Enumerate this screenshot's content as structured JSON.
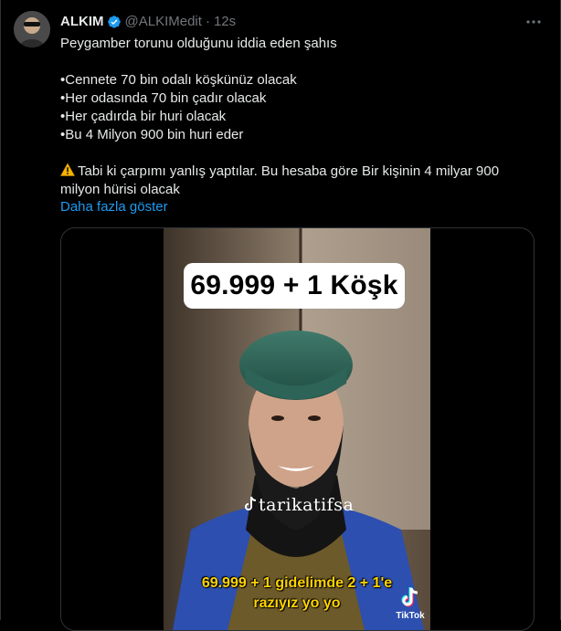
{
  "tweet": {
    "author_name": "ALKIM",
    "author_handle": "@ALKIMedit",
    "separator": "·",
    "time": "12s",
    "lines": [
      "Peygamber torunu olduğunu iddia eden şahıs",
      "",
      "•Cennete 70 bin odalı köşkünüz olacak",
      "•Her odasında 70 bin çadır olacak",
      "•Her çadırda bir huri olacak",
      "•Bu 4 Milyon 900 bin huri eder",
      "",
      "Tabi ki çarpımı yanlış yaptılar. Bu hesaba göre Bir kişinin 4 milyar 900",
      "milyon hürisi olacak"
    ],
    "show_more": "Daha fazla göster"
  },
  "video": {
    "title_overlay": "69.999 + 1 Köşk",
    "watermark": "tarikatifsa",
    "subtitle_line1": "69.999 + 1  gidelimde 2 + 1'e",
    "subtitle_line2": "razıyız yo yo",
    "tiktok_label": "TikTok"
  },
  "colors": {
    "background": "#000000",
    "text": "#e7e9ea",
    "muted": "#71767b",
    "link": "#1d9bf0",
    "verified": "#1d9bf0",
    "subtitle": "#ffd400"
  },
  "icons": [
    "avatar",
    "verified-badge-icon",
    "more-options-icon",
    "warning-icon",
    "tiktok-note-icon",
    "tiktok-logo-icon"
  ]
}
